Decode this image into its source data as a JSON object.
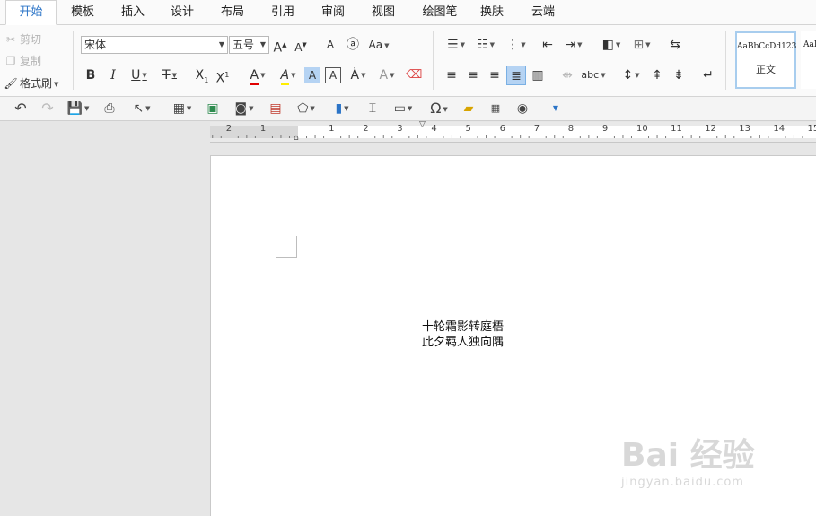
{
  "tabs": [
    "开始",
    "模板",
    "插入",
    "设计",
    "布局",
    "引用",
    "审阅",
    "视图",
    "绘图笔",
    "换肤",
    "云端"
  ],
  "clipboard": {
    "cut": "剪切",
    "copy": "复制",
    "format_painter": "格式刷"
  },
  "font": {
    "name": "宋体",
    "size": "五号"
  },
  "styles": {
    "sample": "AaBbCcDd123",
    "sample2": "AaB",
    "normal": "正文"
  },
  "ruler_numbers": [
    "2",
    "1",
    "1",
    "2",
    "3",
    "4",
    "5",
    "6",
    "7",
    "8",
    "9",
    "10",
    "11",
    "12",
    "13",
    "14",
    "15"
  ],
  "document": {
    "lines": [
      "十轮霜影转庭梧",
      "此夕羁人独向隅"
    ]
  },
  "watermark": {
    "brand": "Bai  经验",
    "url": "jingyan.baidu.com"
  },
  "colors": {
    "accent": "#2b74c7",
    "font_color": "#e00000",
    "highlight": "#ffee00"
  }
}
